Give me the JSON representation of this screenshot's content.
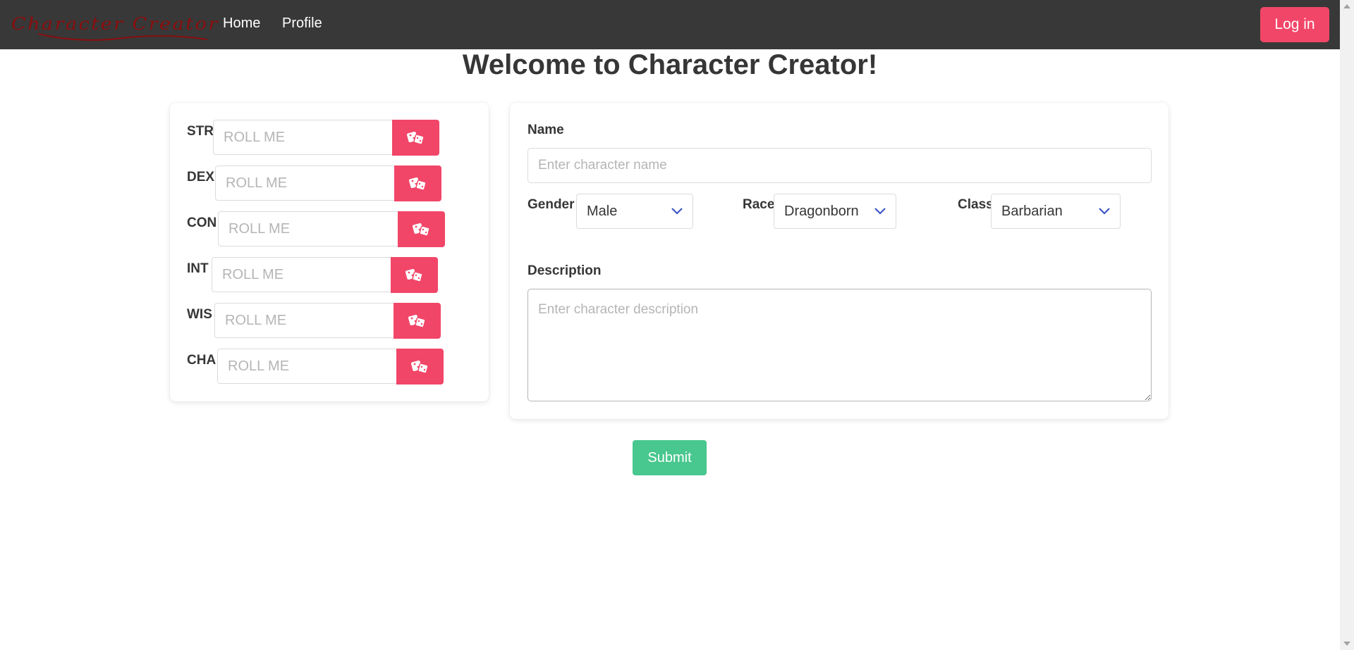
{
  "navbar": {
    "brand_text": "Character Creator",
    "links": [
      {
        "label": "Home"
      },
      {
        "label": "Profile"
      }
    ],
    "login_label": "Log in"
  },
  "page": {
    "title": "Welcome to Character Creator!"
  },
  "stats": [
    {
      "label": "STR",
      "placeholder": "ROLL ME",
      "value": "",
      "button_icon": "dice-icon"
    },
    {
      "label": "DEX",
      "placeholder": "ROLL ME",
      "value": "",
      "button_icon": "dice-icon"
    },
    {
      "label": "CON",
      "placeholder": "ROLL ME",
      "value": "",
      "button_icon": "dice-icon"
    },
    {
      "label": "INT",
      "placeholder": "ROLL ME",
      "value": "",
      "button_icon": "dice-icon"
    },
    {
      "label": "WIS",
      "placeholder": "ROLL ME",
      "value": "",
      "button_icon": "dice-icon"
    },
    {
      "label": "CHA",
      "placeholder": "ROLL ME",
      "value": "",
      "button_icon": "dice-icon"
    }
  ],
  "form": {
    "name_label": "Name",
    "name_placeholder": "Enter character name",
    "name_value": "",
    "gender_label": "Gender",
    "gender_value": "Male",
    "race_label": "Race",
    "race_value": "Dragonborn",
    "class_label": "Class",
    "class_value": "Barbarian",
    "description_label": "Description",
    "description_placeholder": "Enter character description",
    "description_value": "",
    "submit_label": "Submit"
  },
  "colors": {
    "navbar_bg": "#383838",
    "brand_red": "#8b0d0d",
    "danger": "#f14668",
    "success": "#48c78e",
    "select_chevron": "#3e56c4"
  }
}
